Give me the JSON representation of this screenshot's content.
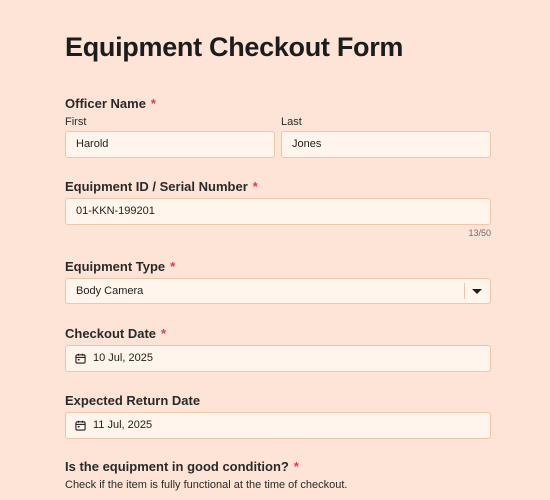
{
  "form": {
    "title": "Equipment Checkout Form",
    "officer_name": {
      "label": "Officer Name",
      "required": "*",
      "first_label": "First",
      "first_value": "Harold",
      "last_label": "Last",
      "last_value": "Jones"
    },
    "equipment_id": {
      "label": "Equipment ID / Serial Number",
      "required": "*",
      "value": "01-KKN-199201",
      "counter": "13/50"
    },
    "equipment_type": {
      "label": "Equipment Type",
      "required": "*",
      "selected": "Body Camera",
      "icon": "chevron-down-icon"
    },
    "checkout_date": {
      "label": "Checkout Date",
      "required": "*",
      "value": "10 Jul, 2025",
      "icon": "calendar-icon"
    },
    "return_date": {
      "label": "Expected Return Date",
      "value": "11 Jul, 2025",
      "icon": "calendar-icon"
    },
    "condition": {
      "label": "Is the equipment in good condition?",
      "required": "*",
      "helper": "Check if the item is fully functional at the time of checkout."
    }
  },
  "colors": {
    "background": "#fde4d6",
    "input_background": "#fff5ec",
    "input_border": "#efc6a8",
    "required": "#e0385f"
  }
}
